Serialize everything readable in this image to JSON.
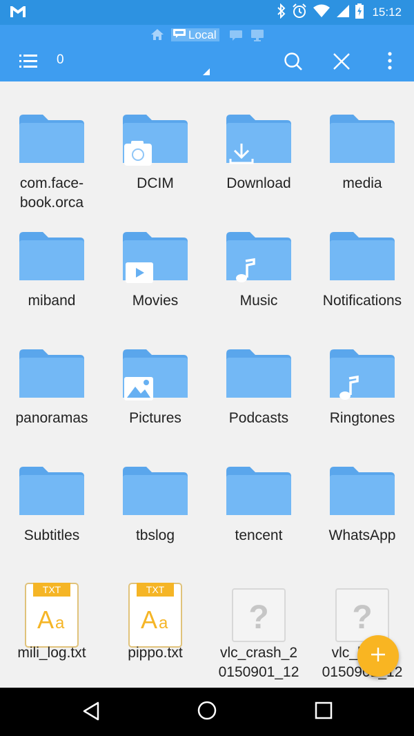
{
  "status_bar": {
    "time": "15:12",
    "icons": [
      "gmail-icon",
      "bluetooth-icon",
      "alarm-icon",
      "wifi-icon",
      "signal-icon",
      "battery-charging-icon"
    ]
  },
  "app_bar": {
    "breadcrumb_local": "Local",
    "selection_count": "0",
    "accent_color": "#3e9df0",
    "status_color": "#2d92e1"
  },
  "files": [
    {
      "name": "com.face-\nbook.orca",
      "type": "folder",
      "badge": ""
    },
    {
      "name": "DCIM",
      "type": "folder",
      "badge": "camera"
    },
    {
      "name": "Download",
      "type": "folder",
      "badge": "download"
    },
    {
      "name": "media",
      "type": "folder",
      "badge": ""
    },
    {
      "name": "miband",
      "type": "folder",
      "badge": ""
    },
    {
      "name": "Movies",
      "type": "folder",
      "badge": "video"
    },
    {
      "name": "Music",
      "type": "folder",
      "badge": "music"
    },
    {
      "name": "Notifications",
      "type": "folder",
      "badge": ""
    },
    {
      "name": "panoramas",
      "type": "folder",
      "badge": ""
    },
    {
      "name": "Pictures",
      "type": "folder",
      "badge": "picture"
    },
    {
      "name": "Podcasts",
      "type": "folder",
      "badge": ""
    },
    {
      "name": "Ringtones",
      "type": "folder",
      "badge": "music"
    },
    {
      "name": "Subtitles",
      "type": "folder",
      "badge": ""
    },
    {
      "name": "tbslog",
      "type": "folder",
      "badge": ""
    },
    {
      "name": "tencent",
      "type": "folder",
      "badge": ""
    },
    {
      "name": "WhatsApp",
      "type": "folder",
      "badge": ""
    },
    {
      "name": "mili_log.txt",
      "type": "txt",
      "badge": "TXT"
    },
    {
      "name": "pippo.txt",
      "type": "txt",
      "badge": "TXT"
    },
    {
      "name": "vlc_crash_2\n0150901_12",
      "type": "unknown",
      "badge": "?"
    },
    {
      "name": "vlc_log_2\n0150901_12",
      "type": "unknown",
      "badge": "?"
    }
  ],
  "txt_badge_text": "TXT",
  "txt_glyph": "Aa",
  "unknown_glyph": "?",
  "fab": {
    "icon": "plus-icon",
    "color": "#f9b522"
  },
  "nav_bar": {
    "icons": [
      "back-icon",
      "home-icon",
      "recents-icon"
    ]
  }
}
